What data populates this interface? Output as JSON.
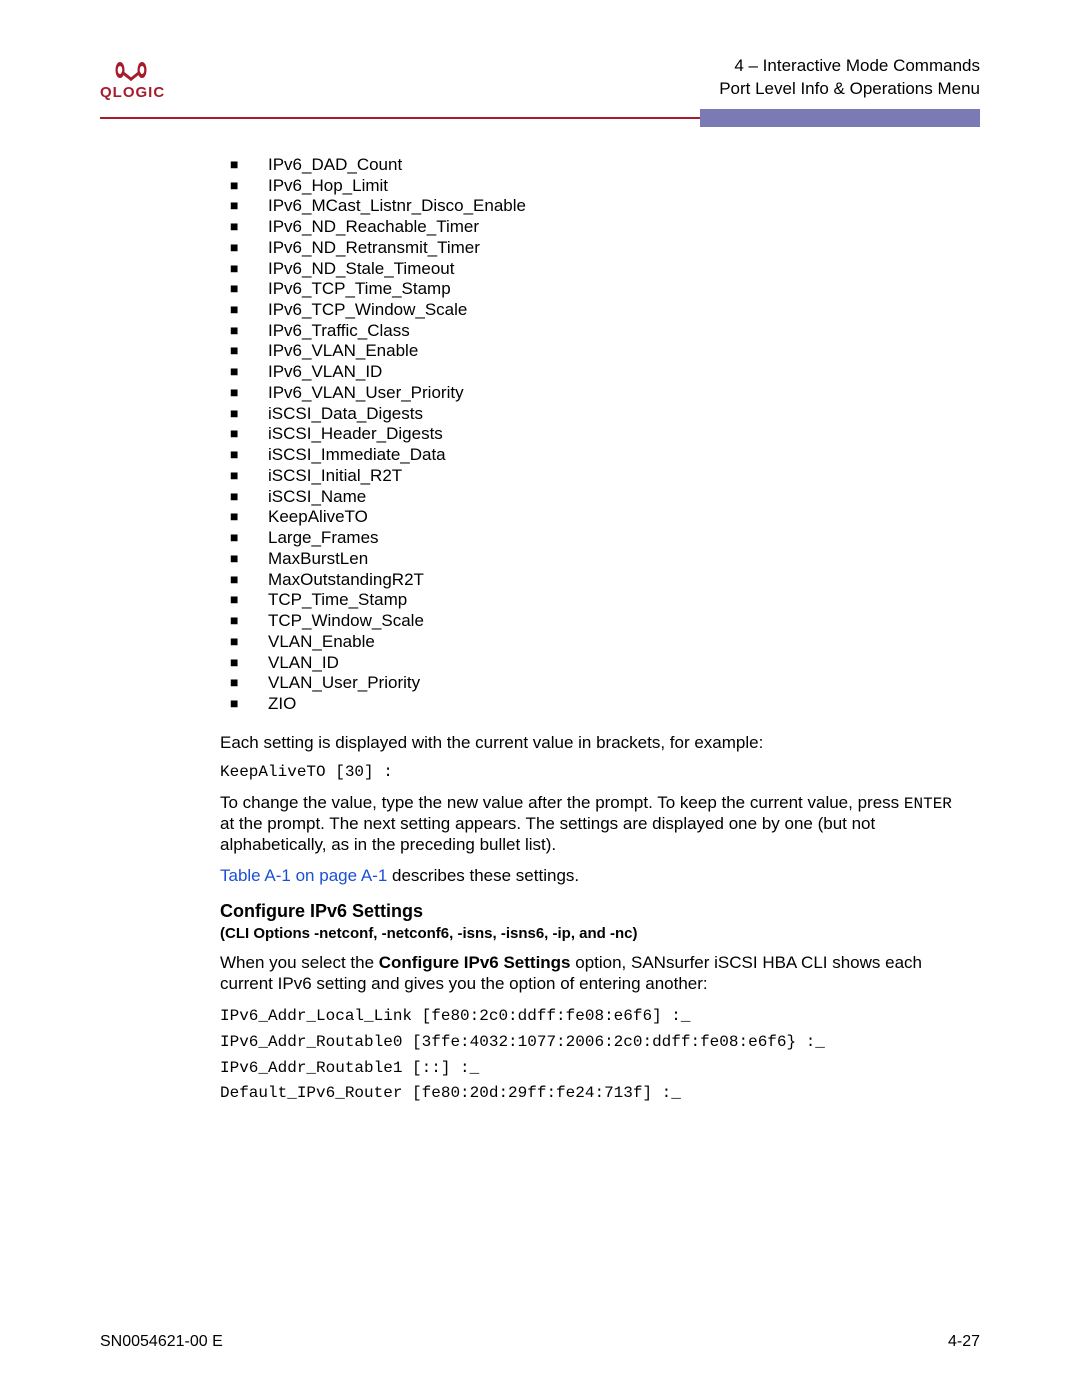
{
  "header": {
    "logo_text": "QLOGIC",
    "line1": "4 – Interactive Mode Commands",
    "line2": "Port Level Info & Operations Menu"
  },
  "params": [
    "IPv6_DAD_Count",
    "IPv6_Hop_Limit",
    "IPv6_MCast_Listnr_Disco_Enable",
    "IPv6_ND_Reachable_Timer",
    "IPv6_ND_Retransmit_Timer",
    "IPv6_ND_Stale_Timeout",
    "IPv6_TCP_Time_Stamp",
    "IPv6_TCP_Window_Scale",
    "IPv6_Traffic_Class",
    "IPv6_VLAN_Enable",
    "IPv6_VLAN_ID",
    "IPv6_VLAN_User_Priority",
    "iSCSI_Data_Digests",
    "iSCSI_Header_Digests",
    "iSCSI_Immediate_Data",
    "iSCSI_Initial_R2T",
    "iSCSI_Name",
    "KeepAliveTO",
    "Large_Frames",
    "MaxBurstLen",
    "MaxOutstandingR2T",
    "TCP_Time_Stamp",
    "TCP_Window_Scale",
    "VLAN_Enable",
    "VLAN_ID",
    "VLAN_User_Priority",
    "ZIO"
  ],
  "body": {
    "p1": "Each setting is displayed with the current value in brackets, for example:",
    "code1": "KeepAliveTO [30] :",
    "p2a": "To change the value, type the new value after the prompt. To keep the current value, press ",
    "p2_enter": "ENTER",
    "p2b": " at the prompt. The next setting appears. The settings are displayed one by one (but not alphabetically, as in the preceding bullet list).",
    "link_text": "Table A-1 on page A-1",
    "p3_rest": " describes these settings.",
    "sec_title": "Configure IPv6 Settings",
    "sec_sub": "(CLI Options -netconf, -netconf6, -isns, -isns6, -ip, and -nc)",
    "p4a": "When you select the ",
    "p4_bold": "Configure IPv6 Settings",
    "p4b": " option, SANsurfer iSCSI HBA CLI shows each current IPv6 setting and gives you the option of entering another:",
    "code2_l1": "IPv6_Addr_Local_Link [fe80:2c0:ddff:fe08:e6f6] :_",
    "code2_l2": "IPv6_Addr_Routable0 [3ffe:4032:1077:2006:2c0:ddff:fe08:e6f6} :_",
    "code2_l3": "IPv6_Addr_Routable1 [::] :_",
    "code2_l4": "Default_IPv6_Router [fe80:20d:29ff:fe24:713f] :_"
  },
  "footer": {
    "left": "SN0054621-00 E",
    "right": "4-27"
  }
}
